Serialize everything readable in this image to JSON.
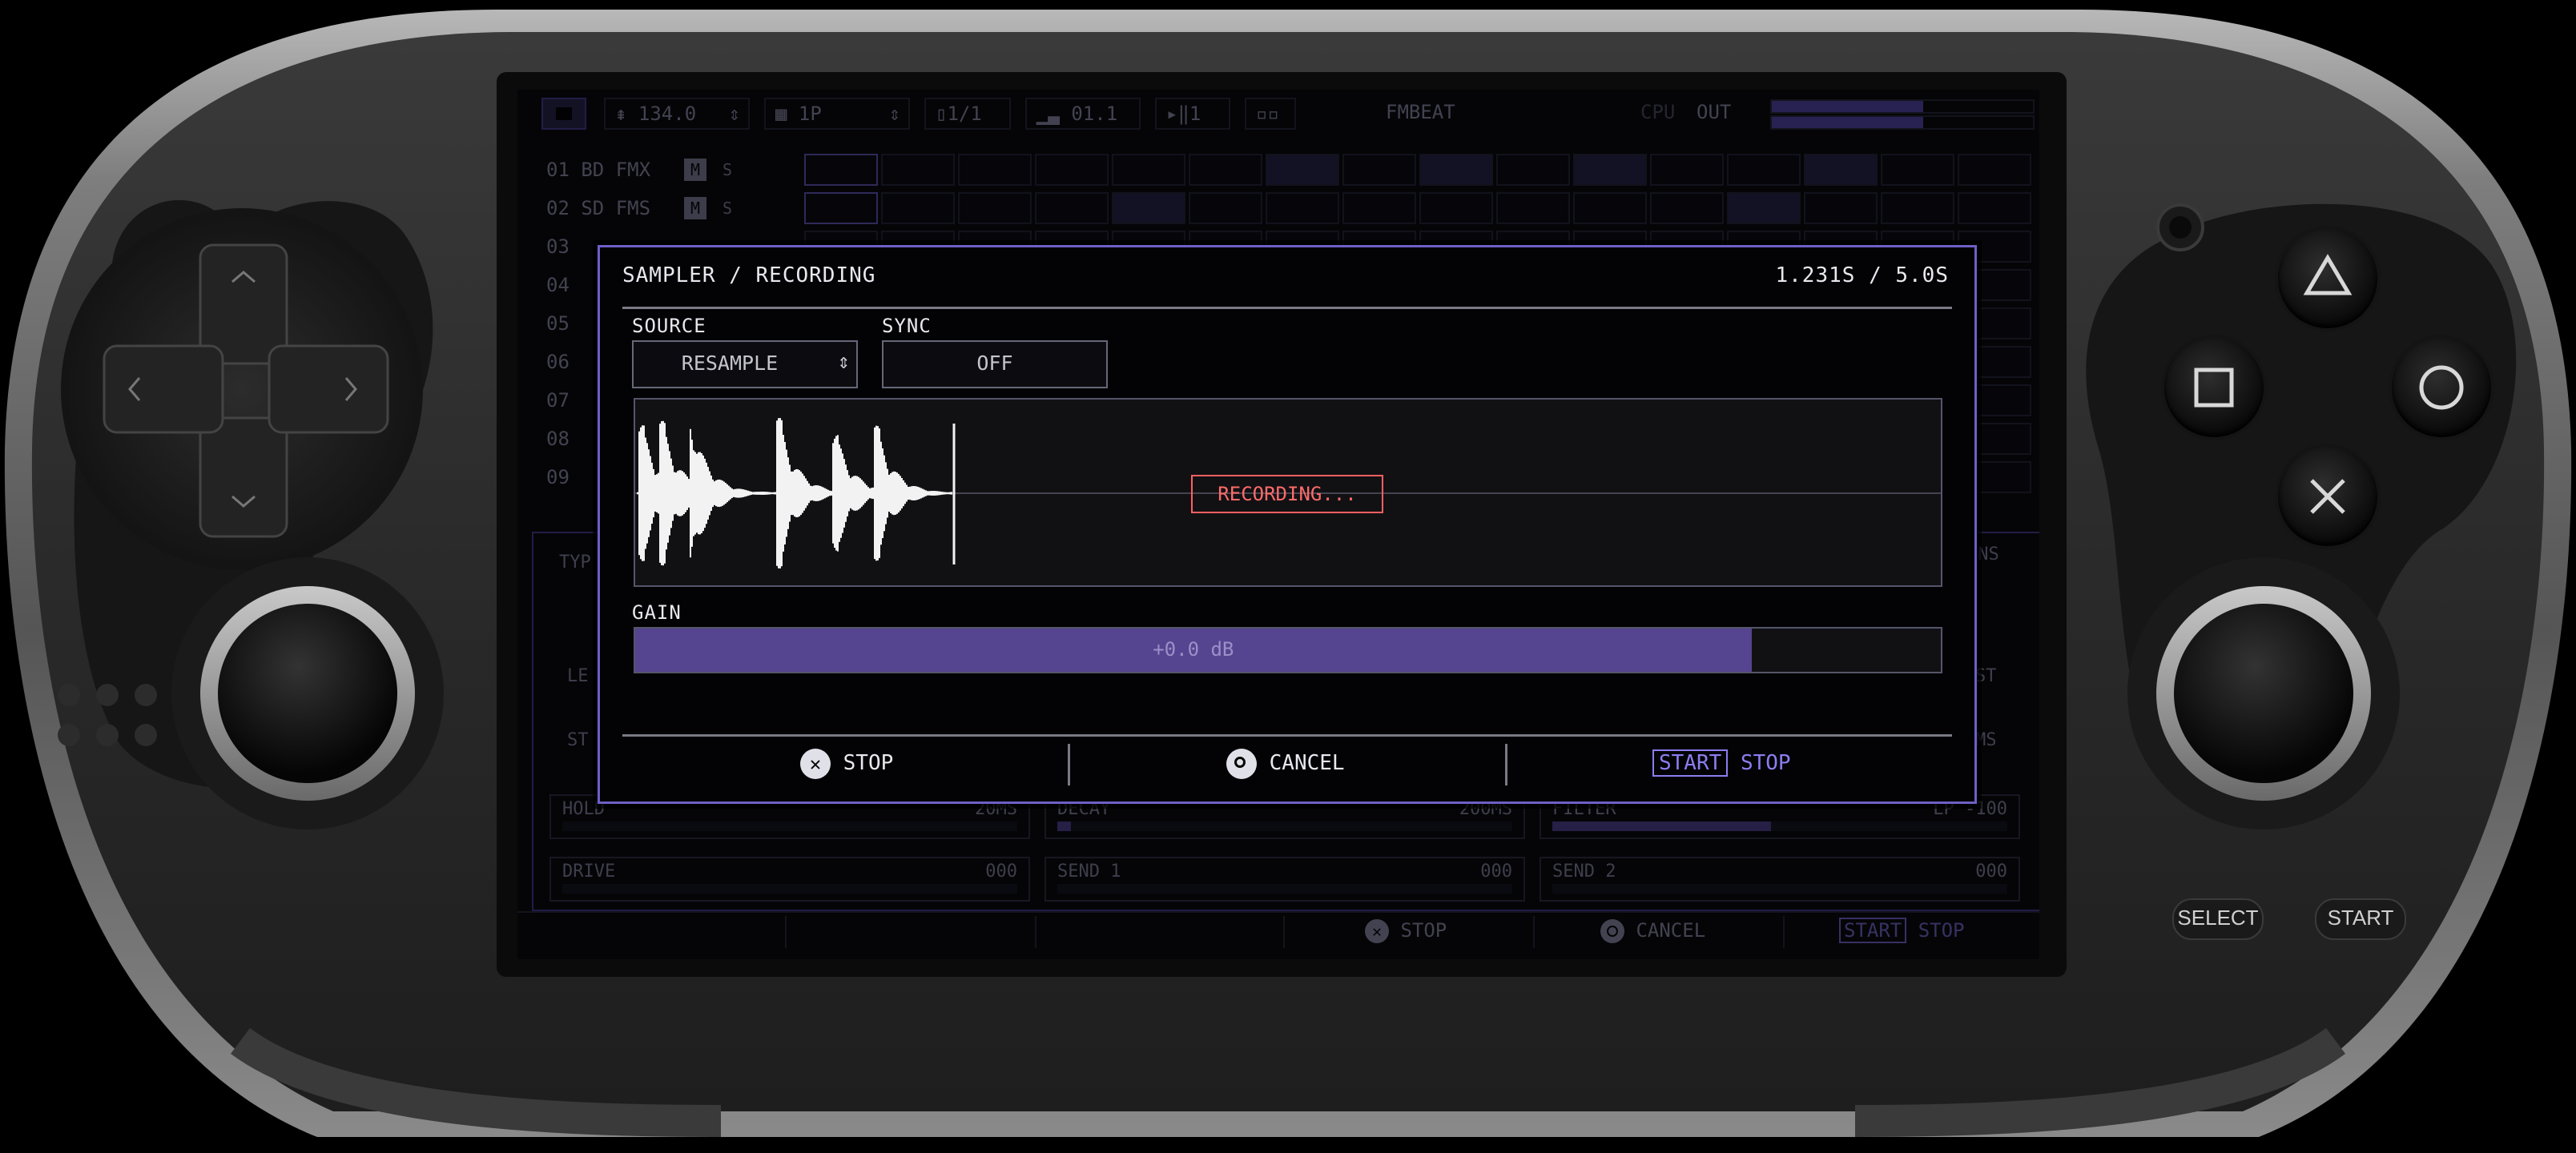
{
  "toolbar": {
    "tempo": "134.0",
    "pattern": "1P",
    "page": "1/1",
    "level": "01.1",
    "play": "1",
    "mode_icon": "▫▫",
    "project": "FMBEAT",
    "cpu_label": "CPU",
    "out_label": "OUT"
  },
  "tracks": [
    {
      "num": "01",
      "name": "BD FMX"
    },
    {
      "num": "02",
      "name": "SD FMS"
    },
    {
      "num": "03",
      "name": ""
    },
    {
      "num": "04",
      "name": ""
    },
    {
      "num": "05",
      "name": ""
    },
    {
      "num": "06",
      "name": ""
    },
    {
      "num": "07",
      "name": ""
    },
    {
      "num": "08",
      "name": ""
    },
    {
      "num": "09",
      "name": ""
    }
  ],
  "track_buttons": {
    "mute": "M",
    "solo": "S"
  },
  "params": {
    "type_label": "TYP",
    "trans_label": "ANS",
    "row2_left": "LE",
    "row2_right": "ST",
    "row3_left": "ST",
    "row3_right": "MS",
    "hold_label": "HOLD",
    "hold_value": "20MS",
    "decay_label": "DECAY",
    "decay_value": "200MS",
    "filter_label": "FILTER",
    "filter_value": "LP -100",
    "drive_label": "DRIVE",
    "drive_value": "000",
    "send1_label": "SEND 1",
    "send1_value": "000",
    "send2_label": "SEND 2",
    "send2_value": "000"
  },
  "bottom_bar": {
    "stop": "STOP",
    "cancel": "CANCEL",
    "start": "START",
    "stop2": "STOP"
  },
  "modal": {
    "title": "SAMPLER / RECORDING",
    "time": "1.231S / 5.0S",
    "source_label": "SOURCE",
    "source_value": "RESAMPLE",
    "sync_label": "SYNC",
    "sync_value": "OFF",
    "status": "RECORDING...",
    "gain_label": "GAIN",
    "gain_value": "+0.0 dB",
    "gain_level": 0.855,
    "footer": {
      "stop": "STOP",
      "cancel": "CANCEL",
      "start": "START",
      "stop2": "STOP"
    }
  },
  "device": {
    "select": "SELECT",
    "start": "START"
  },
  "colors": {
    "accent": "#6d5fc6",
    "gain_fill": "#55448f",
    "recording": "#ff6060"
  }
}
